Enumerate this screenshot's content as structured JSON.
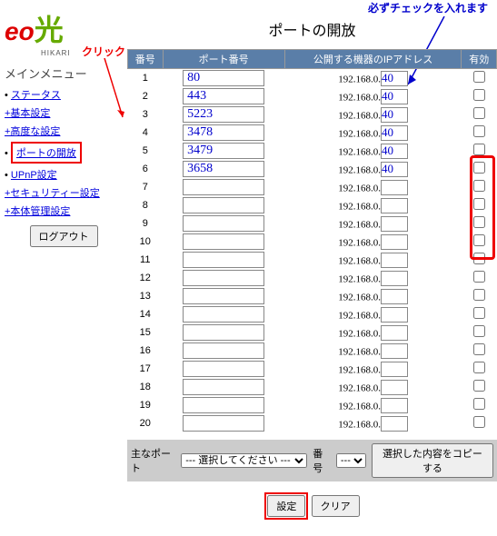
{
  "logo": {
    "brand1": "eo",
    "brand2": "光",
    "sub": "HIKARI"
  },
  "menu_title": "メインメニュー",
  "menu": {
    "status": "ステータス",
    "basic": "+基本設定",
    "advanced": "+高度な設定",
    "port_open": "ポートの開放",
    "upnp": "UPnP設定",
    "security": "+セキュリティー設定",
    "mgmt": "+本体管理設定"
  },
  "logout": "ログアウト",
  "page_title": "ポートの開放",
  "annot_click": "クリック",
  "annot_check": "必ずチェックを入れます",
  "headers": {
    "no": "番号",
    "port": "ポート番号",
    "ip": "公開する機器のIPアドレス",
    "enable": "有効"
  },
  "ip_prefix": "192.168.0.",
  "rows": [
    {
      "n": "1",
      "port": "80",
      "last": "40"
    },
    {
      "n": "2",
      "port": "443",
      "last": "40"
    },
    {
      "n": "3",
      "port": "5223",
      "last": "40"
    },
    {
      "n": "4",
      "port": "3478",
      "last": "40"
    },
    {
      "n": "5",
      "port": "3479",
      "last": "40"
    },
    {
      "n": "6",
      "port": "3658",
      "last": "40"
    },
    {
      "n": "7",
      "port": "",
      "last": ""
    },
    {
      "n": "8",
      "port": "",
      "last": ""
    },
    {
      "n": "9",
      "port": "",
      "last": ""
    },
    {
      "n": "10",
      "port": "",
      "last": ""
    },
    {
      "n": "11",
      "port": "",
      "last": ""
    },
    {
      "n": "12",
      "port": "",
      "last": ""
    },
    {
      "n": "13",
      "port": "",
      "last": ""
    },
    {
      "n": "14",
      "port": "",
      "last": ""
    },
    {
      "n": "15",
      "port": "",
      "last": ""
    },
    {
      "n": "16",
      "port": "",
      "last": ""
    },
    {
      "n": "17",
      "port": "",
      "last": ""
    },
    {
      "n": "18",
      "port": "",
      "last": ""
    },
    {
      "n": "19",
      "port": "",
      "last": ""
    },
    {
      "n": "20",
      "port": "",
      "last": ""
    }
  ],
  "bottom": {
    "main_port_label": "主なポート",
    "main_port_select": "--- 選択してください ---",
    "no_label": "番号",
    "no_select": "---",
    "copy_btn": "選択した内容をコピーする"
  },
  "submit": {
    "set": "設定",
    "clear": "クリア"
  }
}
